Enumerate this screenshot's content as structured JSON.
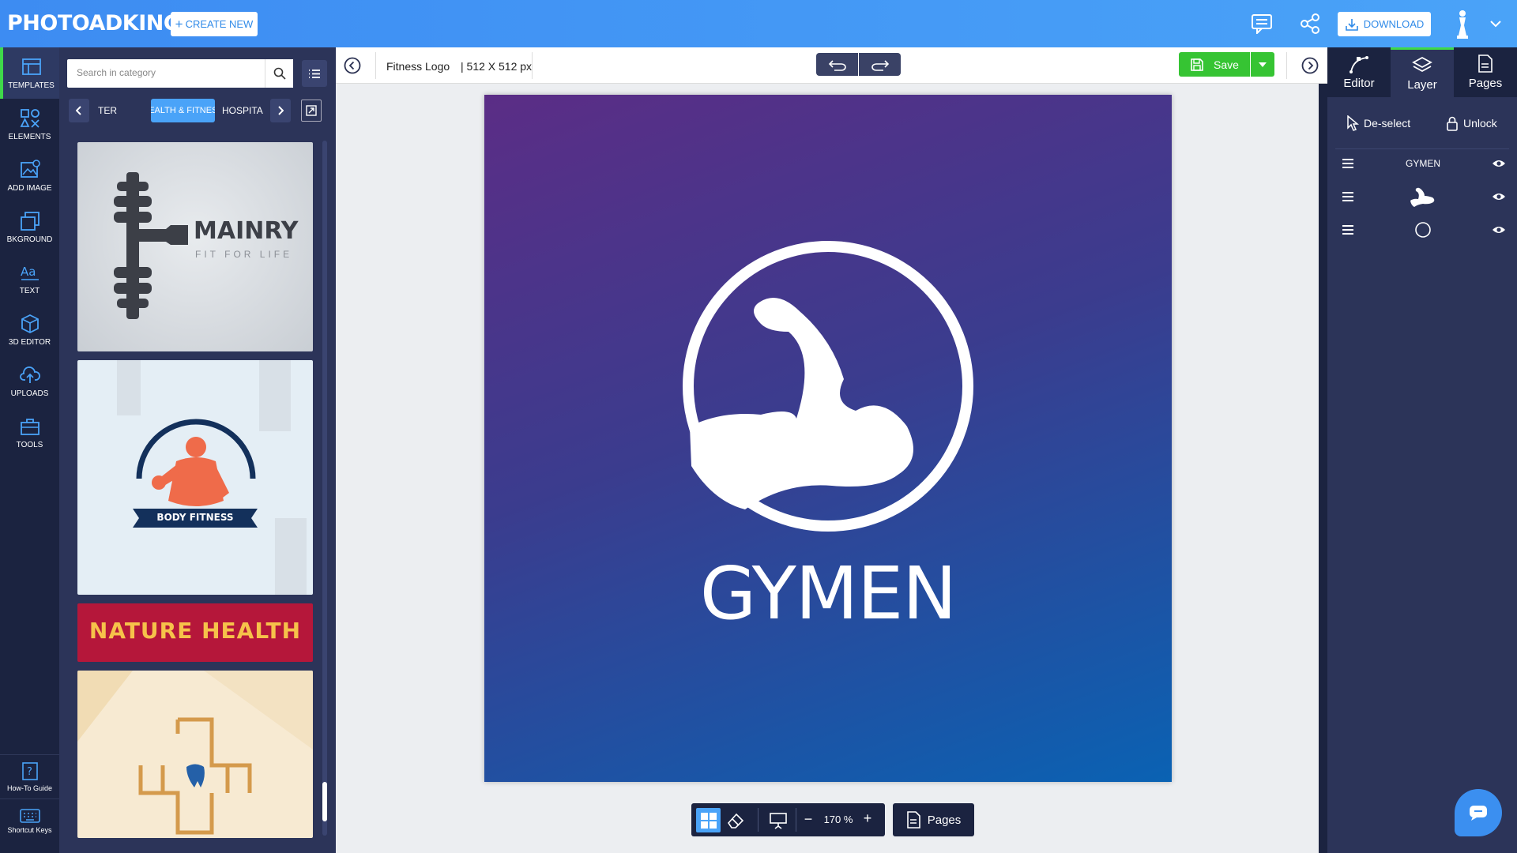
{
  "header": {
    "logo_text": "PHOTOADKING",
    "create_new_label": "CREATE NEW",
    "download_label": "DOWNLOAD",
    "icons": [
      "comment-icon",
      "share-icon",
      "download-icon",
      "user-avatar-icon",
      "chevron-down-icon"
    ]
  },
  "navrail": {
    "items": [
      {
        "label": "TEMPLATES",
        "icon": "templates-icon"
      },
      {
        "label": "ELEMENTS",
        "icon": "elements-icon"
      },
      {
        "label": "ADD IMAGE",
        "icon": "add-image-icon"
      },
      {
        "label": "BKGROUND",
        "icon": "background-icon"
      },
      {
        "label": "TEXT",
        "icon": "text-icon"
      },
      {
        "label": "3D EDITOR",
        "icon": "cube-icon"
      },
      {
        "label": "UPLOADS",
        "icon": "upload-icon"
      },
      {
        "label": "TOOLS",
        "icon": "toolbox-icon"
      }
    ],
    "bottom": [
      {
        "label": "How-To Guide",
        "icon": "help-icon"
      },
      {
        "label": "Shortcut Keys",
        "icon": "keyboard-icon"
      }
    ]
  },
  "panel": {
    "search_placeholder": "Search in category",
    "categories": [
      "TER",
      "HEALTH & FITNESS",
      "HOSPITA"
    ],
    "templates": [
      {
        "brand": "MAINRY",
        "tagline": "FIT FOR LIFE"
      },
      {
        "banner": "BODY FITNESS"
      },
      {
        "title": "NATURE HEALTH"
      },
      {
        "title": ""
      }
    ]
  },
  "toolbar": {
    "doc_title": "Fitness Logo",
    "doc_size": "| 512 X 512 px",
    "save_label": "Save"
  },
  "canvas": {
    "logo_text": "GYMEN",
    "colors": {
      "gradient_top": "#5b2d86",
      "gradient_bottom": "#0a62b3"
    }
  },
  "bottom_bar": {
    "zoom": "170 %",
    "pages_label": "Pages"
  },
  "right_panel": {
    "tabs": [
      "Editor",
      "Layer",
      "Pages"
    ],
    "deselect_label": "De-select",
    "unlock_label": "Unlock",
    "layers": [
      {
        "label": "GYMEN",
        "type": "text"
      },
      {
        "label": "",
        "type": "arm-shape"
      },
      {
        "label": "",
        "type": "circle-shape"
      }
    ]
  },
  "colors": {
    "accent": "#4aa3f8",
    "save_green": "#36c433",
    "nav_dark": "#1b2340",
    "panel": "#2c3459"
  }
}
